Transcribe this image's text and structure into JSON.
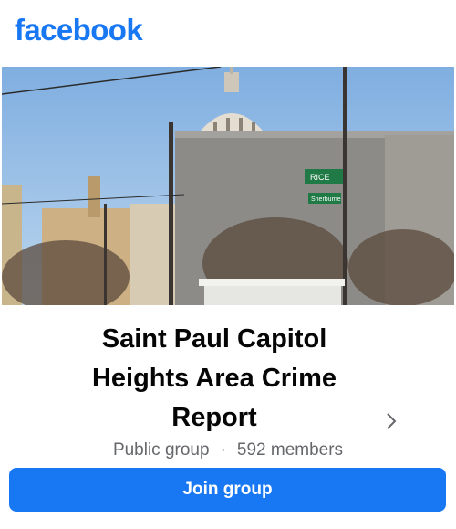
{
  "header": {
    "logo_text": "facebook"
  },
  "cover": {
    "sign_street_1": "RICE",
    "sign_street_2": "Sherburne"
  },
  "group": {
    "title_line_1": "Saint Paul Capitol",
    "title_line_2": "Heights Area Crime",
    "title_line_3": "Report",
    "privacy": "Public group",
    "separator": "·",
    "members": "592 members"
  },
  "actions": {
    "join_label": "Join group"
  },
  "colors": {
    "brand": "#1877f2",
    "secondary_text": "#65676b"
  },
  "icons": {
    "details": "chevron-right-icon"
  }
}
